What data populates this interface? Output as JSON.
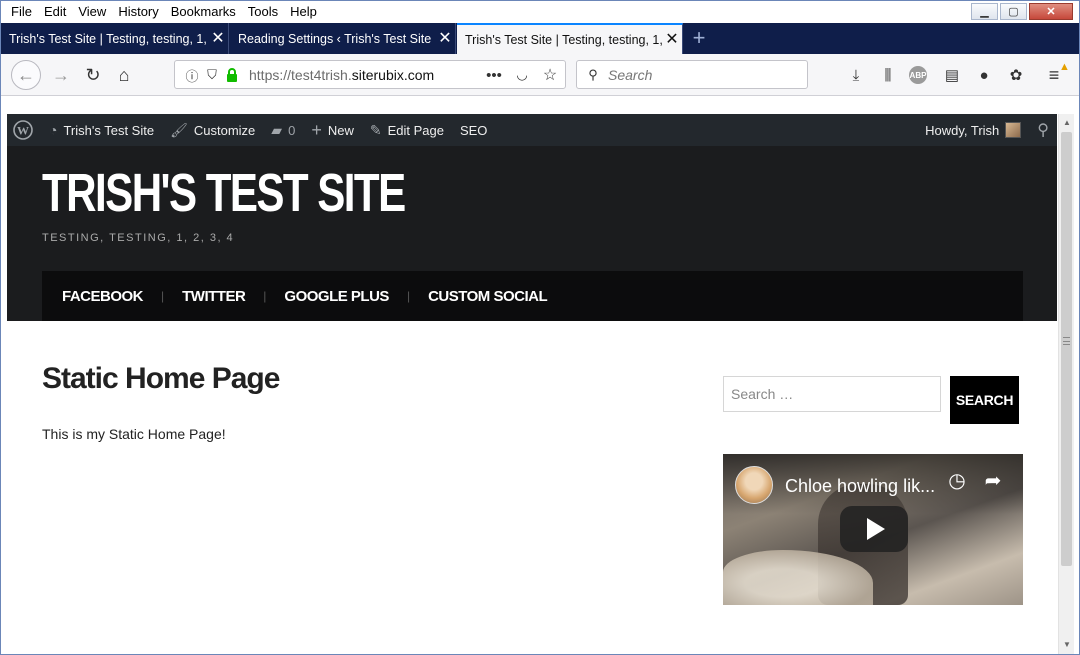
{
  "menubar": {
    "items": [
      "File",
      "Edit",
      "View",
      "History",
      "Bookmarks",
      "Tools",
      "Help"
    ]
  },
  "tabs": [
    {
      "title": "Trish's Test Site | Testing, testing, 1,",
      "active": false
    },
    {
      "title": "Reading Settings ‹ Trish's Test Site -",
      "active": false
    },
    {
      "title": "Trish's Test Site | Testing, testing, 1,",
      "active": true
    }
  ],
  "navbar": {
    "url_prefix": "https://test4trish.",
    "url_domain": "siterubix.com",
    "search_placeholder": "Search"
  },
  "adminbar": {
    "site_name": "Trish's Test Site",
    "customize": "Customize",
    "comments_count": "0",
    "new": "New",
    "edit_page": "Edit Page",
    "seo": "SEO",
    "greeting": "Howdy, Trish"
  },
  "site": {
    "title": "TRISH'S TEST SITE",
    "tagline": "TESTING, TESTING, 1, 2, 3, 4",
    "nav": [
      "FACEBOOK",
      "TWITTER",
      "GOOGLE PLUS",
      "CUSTOM SOCIAL"
    ]
  },
  "main": {
    "page_title": "Static Home Page",
    "page_text": "This is my Static Home Page!"
  },
  "sidebar": {
    "search_placeholder": "Search …",
    "search_button": "SEARCH",
    "video_title": "Chloe howling lik..."
  },
  "colors": {
    "admin_bar": "#23282d",
    "header_bg": "#1b1c1e",
    "tab_bar": "#0f1e4a",
    "secure_lock": "#12bc00"
  }
}
